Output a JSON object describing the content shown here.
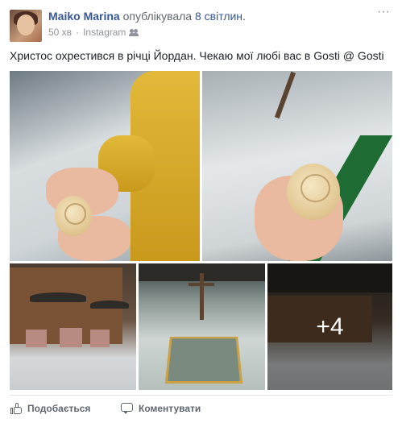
{
  "header": {
    "author": "Maiko Marina",
    "action": "опублікувала",
    "photos_link": "8 світлин.",
    "time": "50 хв",
    "separator": "·",
    "source": "Instagram",
    "audience_icon": "friends-icon",
    "options": "···"
  },
  "post": {
    "text": "Христос охрестився в річці Йордан. Чекаю мої любі вас в Gosti @ Gosti"
  },
  "photos": {
    "more_count": "+4",
    "colors": {
      "snow": "#d8dde0",
      "vestment": "#e2b93a",
      "carpet": "#1e6b34"
    }
  },
  "actions": {
    "like_label": "Подобається",
    "comment_label": "Коментувати"
  },
  "colors": {
    "link": "#365899",
    "meta": "#90949c",
    "text": "#1d2129"
  }
}
